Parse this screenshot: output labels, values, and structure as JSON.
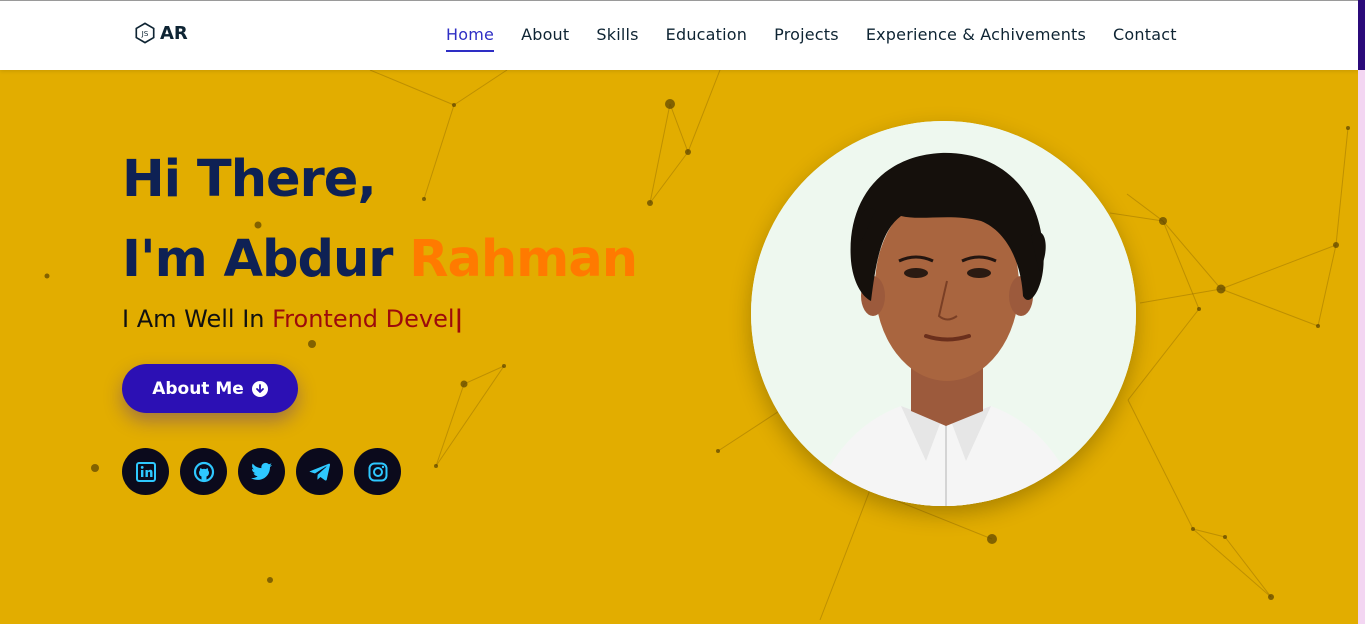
{
  "brand": {
    "logo_icon": "js-hexagon-icon",
    "name": "AR"
  },
  "nav": {
    "items": [
      {
        "label": "Home",
        "active": true
      },
      {
        "label": "About"
      },
      {
        "label": "Skills"
      },
      {
        "label": "Education"
      },
      {
        "label": "Projects"
      },
      {
        "label": "Experience & Achivements"
      },
      {
        "label": "Contact"
      }
    ]
  },
  "hero": {
    "line1": "Hi There,",
    "line2_prefix": "I'm Abdur ",
    "line2_accent": "Rahman",
    "typed_prefix": "I Am Well In ",
    "typed_word": "Frontend Devel",
    "cursor": "|",
    "button_label": "About Me",
    "button_icon": "arrow-down-circle-icon"
  },
  "socials": [
    {
      "name": "linkedin-icon"
    },
    {
      "name": "github-icon"
    },
    {
      "name": "twitter-icon"
    },
    {
      "name": "telegram-icon"
    },
    {
      "name": "instagram-icon"
    }
  ],
  "photo": {
    "subject": "profile-photo"
  },
  "colors": {
    "background": "#e2ad00",
    "heading": "#0e2154",
    "accent_orange": "#ff7a00",
    "typed_red": "#9c0b0b",
    "button": "#2c10b4",
    "nav_active": "#2e2ec4",
    "social_bg": "#0b0a1c",
    "social_icon": "#2ec8ff"
  }
}
